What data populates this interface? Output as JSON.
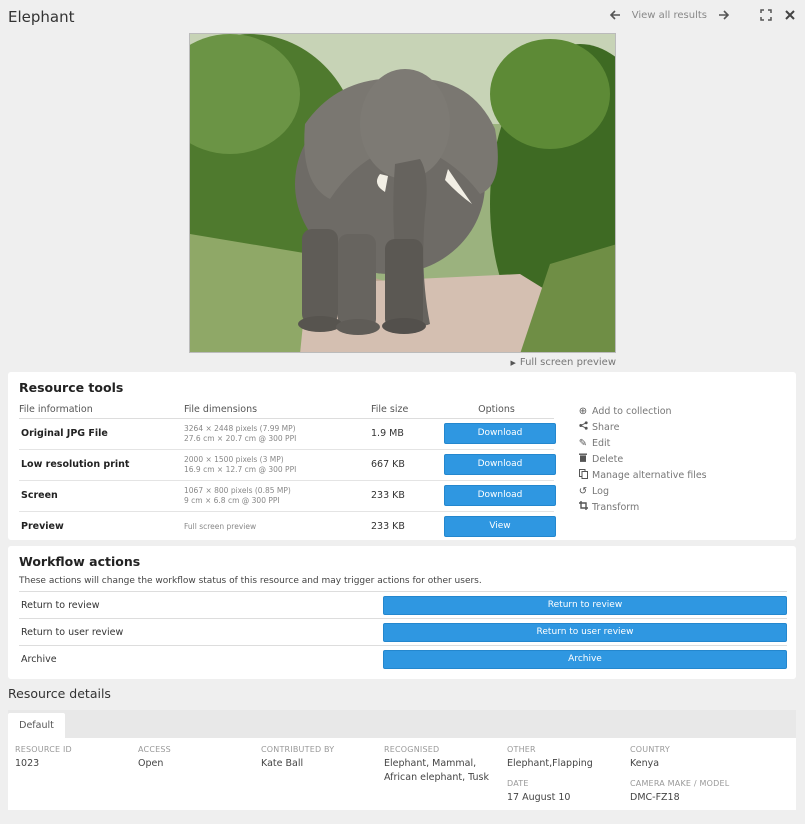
{
  "header": {
    "title": "Elephant",
    "prev_icon": "arrow-left-icon",
    "view_all_label": "View all results",
    "next_icon": "arrow-right-icon",
    "fullscreen_icon": "expand-icon",
    "close_icon": "close-icon"
  },
  "preview": {
    "fullscreen_label": "Full screen preview"
  },
  "resource_tools": {
    "title": "Resource tools",
    "columns": [
      "File information",
      "File dimensions",
      "File size",
      "Options"
    ],
    "files": [
      {
        "name": "Original JPG File",
        "dim1": "3264 × 2448 pixels (7.99 MP)",
        "dim2": "27.6 cm × 20.7 cm @ 300 PPI",
        "size": "1.9 MB",
        "action": "Download"
      },
      {
        "name": "Low resolution print",
        "dim1": "2000 × 1500 pixels (3 MP)",
        "dim2": "16.9 cm × 12.7 cm @ 300 PPI",
        "size": "667 KB",
        "action": "Download"
      },
      {
        "name": "Screen",
        "dim1": "1067 × 800 pixels (0.85 MP)",
        "dim2": "9 cm × 6.8 cm @ 300 PPI",
        "size": "233 KB",
        "action": "Download"
      },
      {
        "name": "Preview",
        "dim1": "Full screen preview",
        "dim2": "",
        "size": "233 KB",
        "action": "View"
      }
    ],
    "links": [
      {
        "label": "Add to collection",
        "icon": "plus-circle-icon"
      },
      {
        "label": "Share",
        "icon": "share-icon"
      },
      {
        "label": "Edit",
        "icon": "pencil-icon"
      },
      {
        "label": "Delete",
        "icon": "trash-icon"
      },
      {
        "label": "Manage alternative files",
        "icon": "copy-icon"
      },
      {
        "label": "Log",
        "icon": "history-icon"
      },
      {
        "label": "Transform",
        "icon": "crop-icon"
      }
    ]
  },
  "workflow": {
    "title": "Workflow actions",
    "description": "These actions will change the workflow status of this resource and may trigger actions for other users.",
    "rows": [
      {
        "label": "Return to review",
        "button": "Return to review"
      },
      {
        "label": "Return to user review",
        "button": "Return to user review"
      },
      {
        "label": "Archive",
        "button": "Archive"
      }
    ]
  },
  "details": {
    "title": "Resource details",
    "tab": "Default",
    "fields": [
      {
        "key": "RESOURCE ID",
        "value": "1023"
      },
      {
        "key": "ACCESS",
        "value": "Open"
      },
      {
        "key": "CONTRIBUTED BY",
        "value": "Kate Ball"
      },
      {
        "key": "RECOGNISED",
        "value": "Elephant, Mammal, African elephant, Tusk"
      },
      {
        "key": "OTHER",
        "value": "Elephant,Flapping"
      },
      {
        "key": "COUNTRY",
        "value": "Kenya"
      },
      {
        "key": "DATE",
        "value": "17 August 10"
      },
      {
        "key": "CAMERA MAKE / MODEL",
        "value": "DMC-FZ18"
      }
    ]
  },
  "colors": {
    "accent": "#2f97e1",
    "background": "#efefef"
  }
}
